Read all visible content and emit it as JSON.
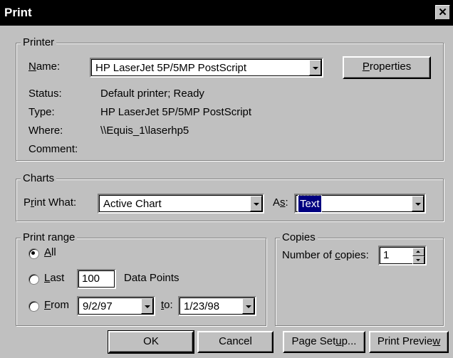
{
  "window": {
    "title": "Print",
    "close_glyph": "✕"
  },
  "printer": {
    "legend": "Printer",
    "name_label": "Name:",
    "name_value": "HP LaserJet 5P/5MP PostScript",
    "properties_label": "Properties",
    "status_label": "Status:",
    "status_value": "Default printer; Ready",
    "type_label": "Type:",
    "type_value": "HP LaserJet 5P/5MP PostScript",
    "where_label": "Where:",
    "where_value": "\\\\Equis_1\\laserhp5",
    "comment_label": "Comment:"
  },
  "charts": {
    "legend": "Charts",
    "print_what_label": "Print What:",
    "print_what_value": "Active Chart",
    "as_label": "As:",
    "as_value": "Text"
  },
  "print_range": {
    "legend": "Print range",
    "all_label": "All",
    "last_label": "Last",
    "last_value": "100",
    "data_points_label": "Data Points",
    "from_label": "From",
    "from_value": "9/2/97",
    "to_label": "to:",
    "to_value": "1/23/98",
    "selected": "All"
  },
  "copies": {
    "legend": "Copies",
    "number_label": "Number of copies:",
    "number_value": "1"
  },
  "buttons": {
    "ok": "OK",
    "cancel": "Cancel",
    "page_setup": "Page Setup...",
    "print_preview": "Print Preview"
  }
}
